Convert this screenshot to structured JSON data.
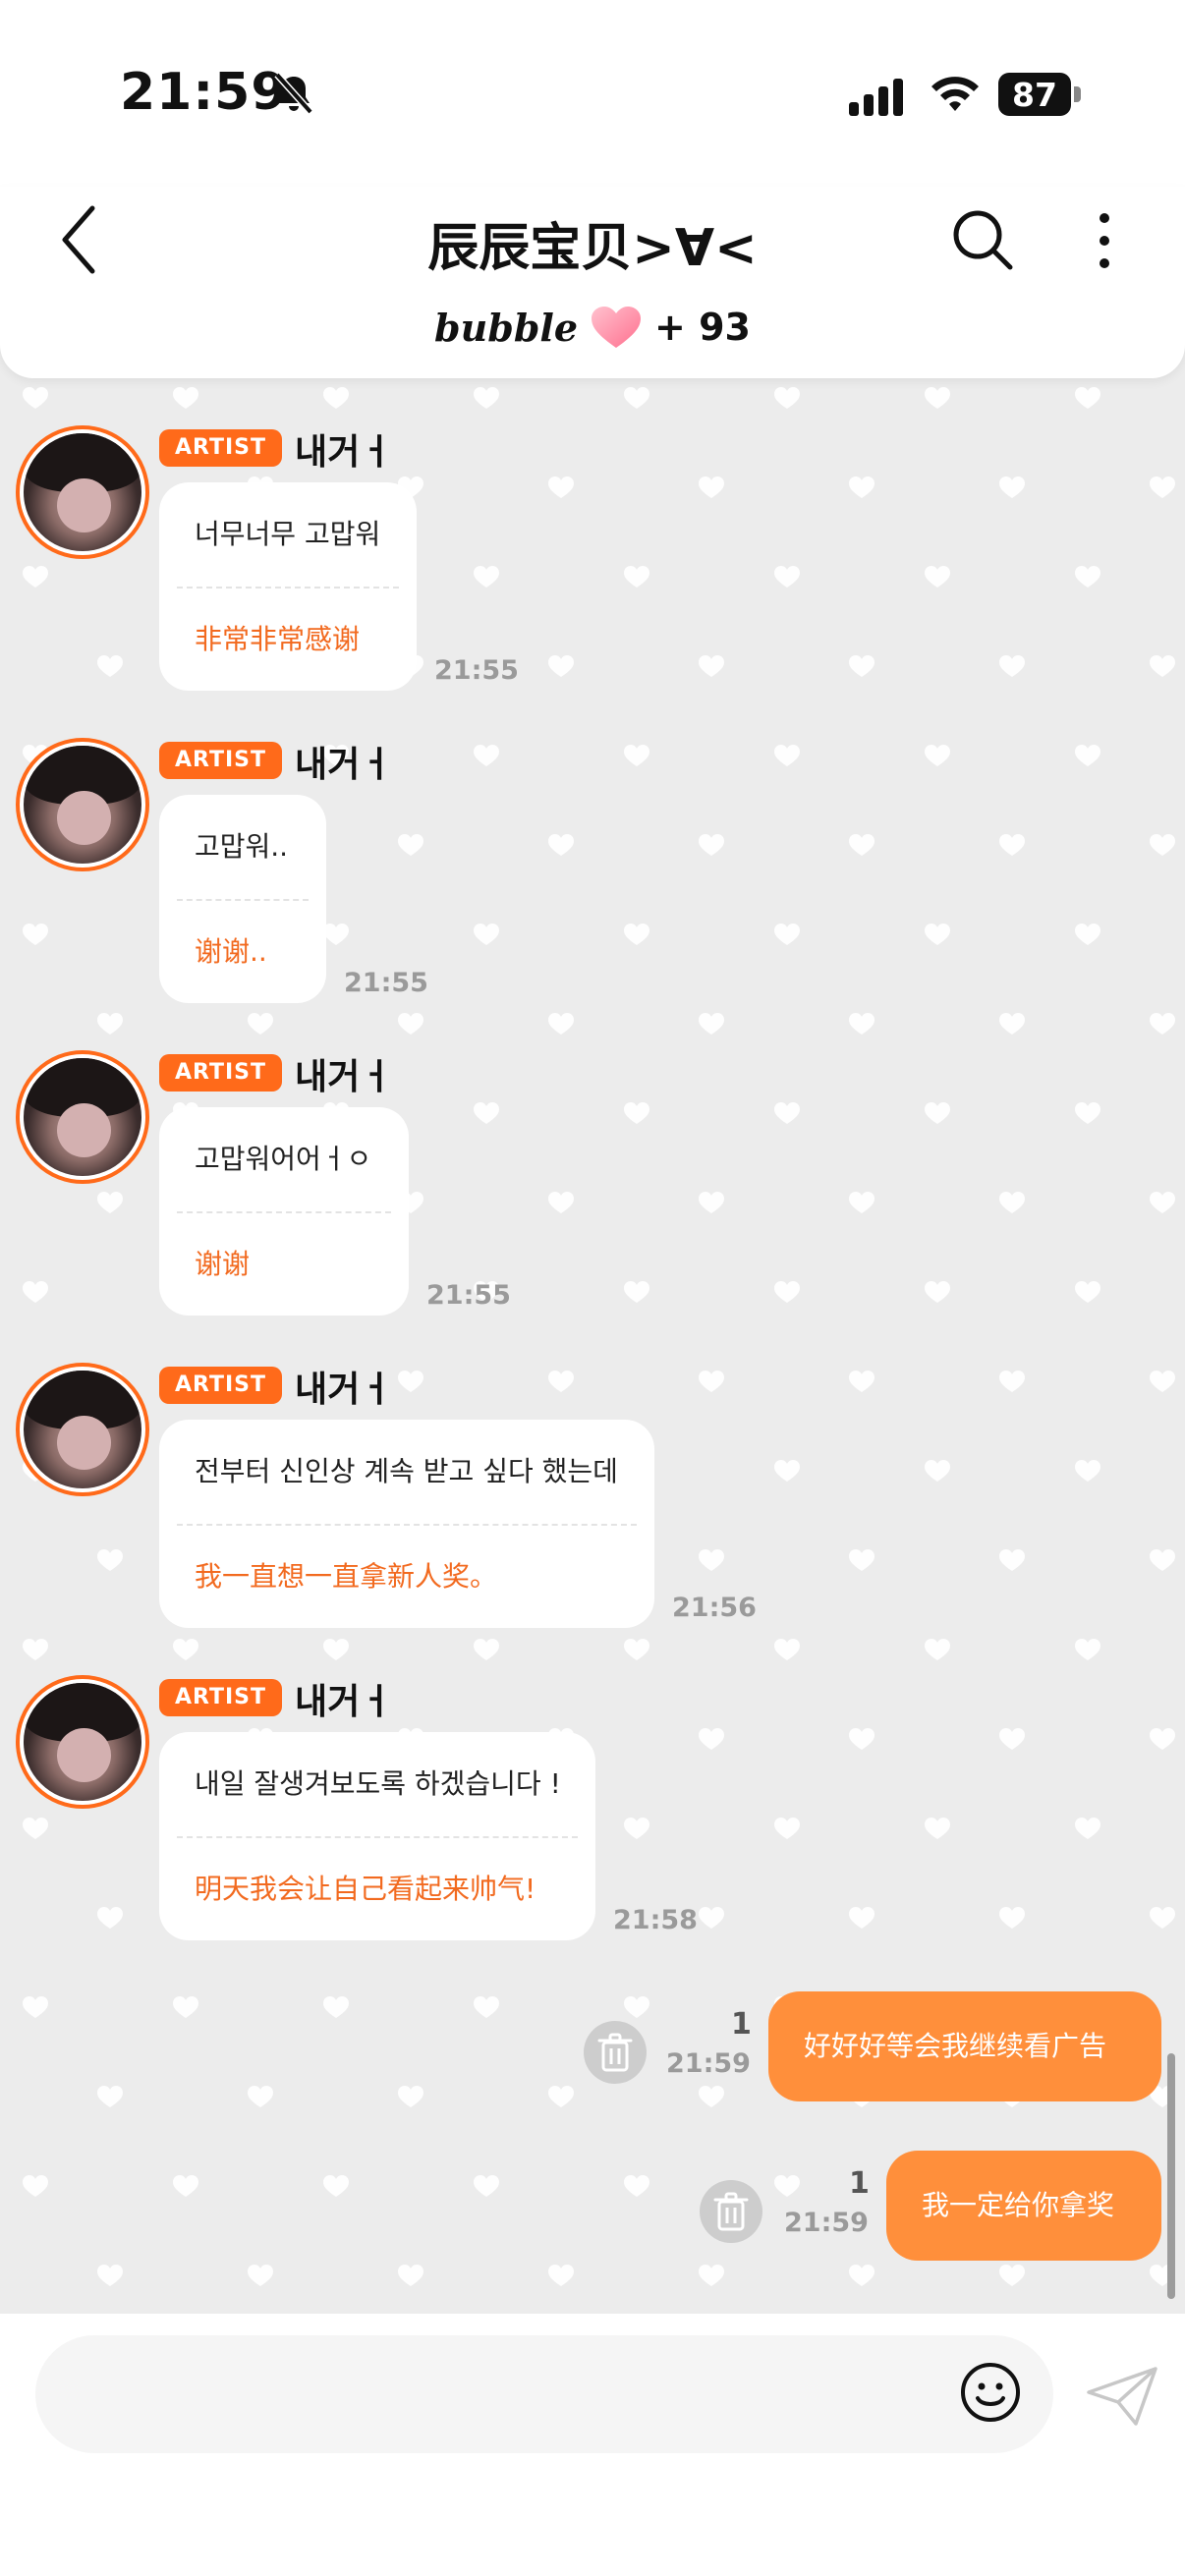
{
  "status_bar": {
    "time": "21:59",
    "battery": "87",
    "icons": [
      "bell-off-icon",
      "signal-icon",
      "wifi-icon",
      "battery-icon"
    ]
  },
  "header": {
    "back_icon": "chevron-left-icon",
    "title": "辰辰宝贝>∀<",
    "search_icon": "search-icon",
    "more_icon": "more-vertical-icon",
    "brand": "bubble",
    "heart_icon": "pink-heart-icon",
    "count": "+ 93"
  },
  "messages": [
    {
      "badge": "ARTIST",
      "name": "내거ㅓ",
      "text": "너무너무 고맙워",
      "translation": "非常非常感谢",
      "time": "21:55"
    },
    {
      "badge": "ARTIST",
      "name": "내거ㅓ",
      "text": "고맙워..",
      "translation": "谢谢..",
      "time": "21:55"
    },
    {
      "badge": "ARTIST",
      "name": "내거ㅓ",
      "text": "고맙워어어ㅓㅇ",
      "translation": "谢谢",
      "time": "21:55"
    },
    {
      "badge": "ARTIST",
      "name": "내거ㅓ",
      "text": "전부터 신인상 계속 받고 싶다 했는데",
      "translation": "我一直想一直拿新人奖。",
      "time": "21:56"
    },
    {
      "badge": "ARTIST",
      "name": "내거ㅓ",
      "text": "내일 잘생겨보도록 하겠습니다 !",
      "translation": "明天我会让自己看起来帅气!",
      "time": "21:58"
    }
  ],
  "my_messages": [
    {
      "text": "好好好等会我继续看广告",
      "time": "21:59",
      "unread": "1"
    },
    {
      "text": "我一定给你拿奖",
      "time": "21:59",
      "unread": "1"
    }
  ],
  "input": {
    "placeholder": "",
    "emoji_icon": "emoji-icon",
    "send_icon": "send-icon"
  },
  "colors": {
    "accent": "#ff6a1a",
    "my_bubble": "#ff8f3b",
    "translation_text": "#f26a1f",
    "chat_background": "#ececec"
  }
}
